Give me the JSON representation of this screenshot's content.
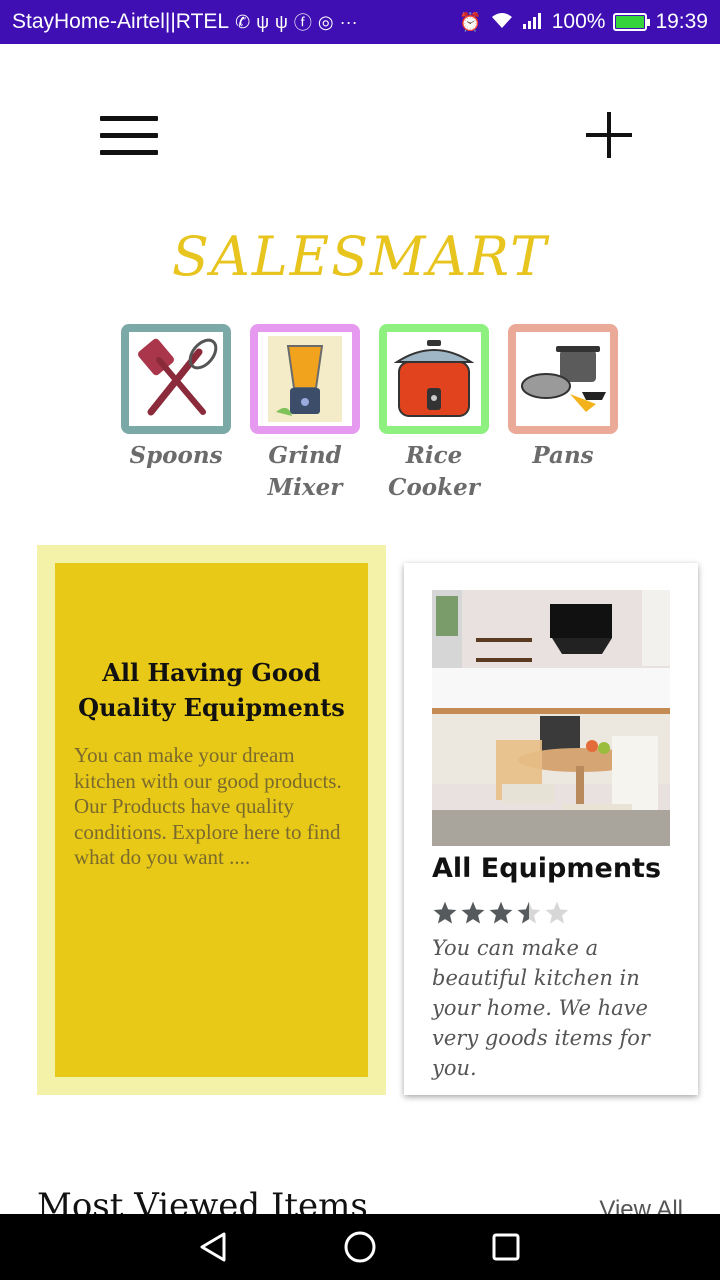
{
  "status_bar": {
    "carrier": "StayHome-Airtel||RTEL",
    "battery": "100%",
    "time": "19:39",
    "icons": [
      "phone-icon",
      "usb-icon",
      "usb-icon",
      "facebook-icon",
      "messenger-icon",
      "more-icon",
      "alarm-icon",
      "wifi-icon",
      "signal-icon",
      "battery-icon"
    ]
  },
  "header": {
    "brand": "SALESMART",
    "menu_icon": "hamburger-menu-icon",
    "add_icon": "plus-icon"
  },
  "categories": [
    {
      "label": "Spoons",
      "color": "#7ba9a8",
      "icon": "spoons-icon"
    },
    {
      "label": "Grind Mixer",
      "color": "#e59af0",
      "icon": "mixer-icon"
    },
    {
      "label": "Rice Cooker",
      "color": "#8df07f",
      "icon": "rice-cooker-icon"
    },
    {
      "label": "Pans",
      "color": "#ebaa98",
      "icon": "pans-icon"
    }
  ],
  "promo": {
    "title": "All Having Good Quality Equipments",
    "text": "You can make your dream kitchen with our good products. Our Products have quality conditions. Explore here to find what do you want ....",
    "outer_color": "#f4f2a9",
    "inner_color": "#e8c918"
  },
  "featured_card": {
    "title": "All Equipments",
    "rating": 3.5,
    "rating_max": 5,
    "text": "You can make a beautiful kitchen in your home. We have very goods items for you."
  },
  "section": {
    "title": "Most Viewed Items",
    "view_all": "View All"
  },
  "colors": {
    "status_bar": "#3f0fb3",
    "brand": "#e8c41f",
    "star_filled": "#555a5c",
    "star_empty": "#d7d7d7"
  }
}
